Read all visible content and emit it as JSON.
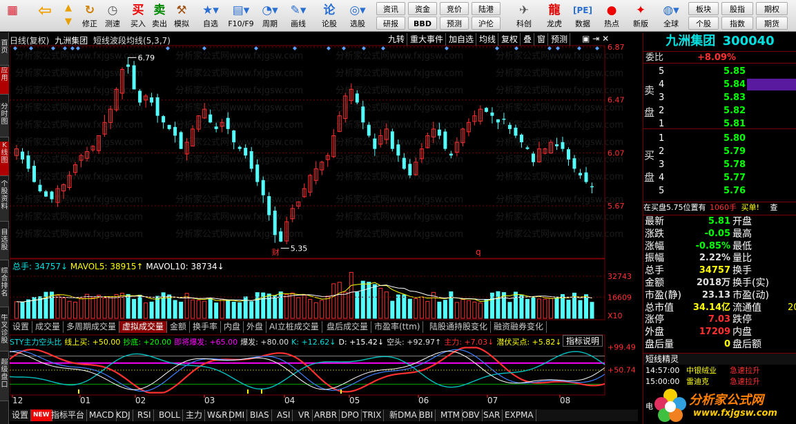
{
  "toolbar": {
    "buttons": [
      {
        "label": "",
        "icon": "back-arrow-icon"
      },
      {
        "label": "修正",
        "icon": "refresh-icon"
      },
      {
        "label": "测速",
        "icon": "clock-icon"
      },
      {
        "label": "买入",
        "icon": "buy-icon",
        "glyph": "买"
      },
      {
        "label": "卖出",
        "icon": "sell-icon",
        "glyph": "卖"
      },
      {
        "label": "模拟",
        "icon": "hammer-icon"
      },
      {
        "label": "自选",
        "icon": "star-icon"
      },
      {
        "label": "F10/F9",
        "icon": "document-icon"
      },
      {
        "label": "周期",
        "icon": "cycle-icon"
      },
      {
        "label": "画线",
        "icon": "pen-icon"
      },
      {
        "label": "论股",
        "icon": "discuss-icon"
      },
      {
        "label": "选股",
        "icon": "chart-select-icon"
      }
    ],
    "small_buttons": [
      "资讯",
      "资金",
      "竞价",
      "陆港",
      "研报",
      "BBD",
      "预测",
      "沪伦"
    ],
    "right_buttons": [
      {
        "label": "科创",
        "icon": "rocket-icon"
      },
      {
        "label": "龙虎",
        "icon": "dragon-icon"
      },
      {
        "label": "数据",
        "icon": "pe-icon"
      },
      {
        "label": "热点",
        "icon": "hot-icon"
      },
      {
        "label": "新版",
        "icon": "new-version-icon"
      },
      {
        "label": "全球",
        "icon": "globe-icon"
      }
    ],
    "far_right": [
      "板块",
      "股指",
      "期权",
      "个股",
      "指数",
      "期货"
    ]
  },
  "left_tabs": [
    "首页",
    "应用",
    "分时图",
    "K线图",
    "个股资料",
    "自选股",
    "综合排名",
    "牛叉诊股",
    "超级盘口"
  ],
  "chart": {
    "title_parts": [
      "日线(复权)",
      "九洲集团",
      "短线波段均线(5,3,7)"
    ],
    "top_buttons": [
      "九转",
      "重大事件",
      "加自选",
      "均线",
      "复权",
      "叠",
      "窗",
      "预测"
    ],
    "price_high_label": "6.79",
    "price_low_label": "5.35",
    "marker_cai": "财",
    "marker_q": "q",
    "watermark": "分析家公式网www.fxjgsw.com",
    "price_axis": [
      "6.87",
      "6.47",
      "6.07",
      "5.67"
    ],
    "vol_axis": [
      "32743",
      "16609",
      "X10"
    ],
    "osc_axis": [
      "+99.49",
      "+50.74"
    ],
    "volume_legend": [
      {
        "text": "总手: 34757↓",
        "color": "#00e0e0"
      },
      {
        "text": "MAVOL5: 38915↑",
        "color": "#ffff00"
      },
      {
        "text": "MAVOL10: 38734↓",
        "color": "#ffffff"
      }
    ],
    "tabs": [
      "设置",
      "成交量",
      "多周期成交量",
      "虚拟成交量",
      "金额",
      "换手率",
      "内盘",
      "外盘",
      "AI立桩成交量",
      "盘后成交量",
      "市盈率(ttm)",
      "陆股通持股变化",
      "融资融券变化"
    ],
    "active_tab": "虚拟成交量",
    "osc_legend": [
      {
        "text": "STY主力空头比",
        "color": "#00e0e0"
      },
      {
        "text": "线上买: +50.00",
        "color": "#ffff00"
      },
      {
        "text": "抄底: +20.00",
        "color": "#00ff00"
      },
      {
        "text": "即将爆发: +65.00",
        "color": "#ff00ff"
      },
      {
        "text": "爆发: +80.00",
        "color": "#e0e0e0"
      },
      {
        "text": "K: +12.62↓",
        "color": "#00e0e0"
      },
      {
        "text": "D: +15.42↓",
        "color": "#ffffff"
      },
      {
        "text": "空头: +92.97↑",
        "color": "#e0e0e0"
      },
      {
        "text": "主力: +7.03↓",
        "color": "#ff3030"
      },
      {
        "text": "潜伏买点: +5.82↓",
        "color": "#ffff00"
      }
    ],
    "osc_button": "指标说明",
    "months": [
      "12",
      "01",
      "02",
      "03",
      "04",
      "05",
      "06",
      "07",
      "08"
    ],
    "bottom_tabs": [
      "设置",
      "NEW",
      "指标平台",
      "MACD",
      "KDJ",
      "RSI",
      "BOLL",
      "主力",
      "W&R",
      "DMI",
      "BIAS",
      "ASI",
      "VR",
      "ARBR",
      "DPO",
      "TRIX",
      "新DMA",
      "BBI",
      "MTM",
      "OBV",
      "SAR",
      "EXPMA"
    ]
  },
  "chart_data": {
    "type": "candlestick",
    "months": [
      "12",
      "01",
      "02",
      "03",
      "04",
      "05",
      "06",
      "07",
      "08"
    ],
    "price_axis_ticks": [
      6.87,
      6.47,
      6.07,
      5.67
    ],
    "high": 6.79,
    "low": 5.35,
    "volume_axis_ticks": [
      32743,
      16609
    ],
    "volume": {
      "total": 34757,
      "mavol5": 38915,
      "mavol10": 38734
    },
    "oscillator": {
      "K": 12.62,
      "D": 15.42,
      "空头": 92.97,
      "主力": 7.03,
      "潜伏买点": 5.82,
      "线上买": 50.0,
      "抄底": 20.0,
      "即将爆发": 65.0,
      "爆发": 80.0
    },
    "close_path": [
      6.1,
      6.02,
      5.95,
      5.85,
      5.78,
      5.74,
      5.72,
      5.8,
      5.83,
      5.9,
      5.98,
      6.05,
      6.08,
      6.12,
      6.2,
      6.3,
      6.4,
      6.55,
      6.7,
      6.72,
      6.55,
      6.45,
      6.5,
      6.45,
      6.35,
      6.3,
      6.25,
      6.2,
      6.1,
      6.15,
      6.25,
      6.35,
      6.4,
      6.3,
      6.25,
      6.3,
      6.25,
      6.15,
      6.1,
      6.05,
      5.95,
      5.85,
      5.75,
      5.6,
      5.45,
      5.4,
      5.55,
      5.65,
      5.7,
      5.8,
      5.9,
      5.95,
      6.0,
      6.05,
      6.2,
      6.35,
      6.5,
      6.55,
      6.45,
      6.3,
      6.2,
      6.1,
      6.2,
      6.25,
      6.1,
      6.05,
      5.95,
      5.9,
      6.0,
      6.1,
      6.2,
      6.25,
      6.2,
      6.1,
      6.05,
      6.15,
      6.25,
      6.3,
      6.35,
      6.4,
      6.38,
      6.35,
      6.3,
      6.32,
      6.25,
      6.2,
      6.15,
      6.1,
      6.0,
      6.1,
      6.1,
      6.15,
      6.12,
      6.1,
      6.02,
      5.95,
      5.9,
      5.85,
      5.81
    ]
  },
  "panel": {
    "name": "九洲集团",
    "code": "300040",
    "weibi_label": "委比",
    "weibi_value": "+8.09%",
    "sell_side_label": "卖盘",
    "buy_side_label": "买盘",
    "sell": [
      {
        "n": "5",
        "p": "5.85"
      },
      {
        "n": "4",
        "p": "5.84"
      },
      {
        "n": "3",
        "p": "5.83"
      },
      {
        "n": "2",
        "p": "5.82"
      },
      {
        "n": "1",
        "p": "5.81"
      }
    ],
    "buy": [
      {
        "n": "1",
        "p": "5.80"
      },
      {
        "n": "2",
        "p": "5.79"
      },
      {
        "n": "3",
        "p": "5.78"
      },
      {
        "n": "4",
        "p": "5.77"
      },
      {
        "n": "5",
        "p": "5.76"
      }
    ],
    "notice_a": "在买盘5.75位置有",
    "notice_b": "1060手",
    "notice_c": "买单!",
    "notice_d": "查",
    "quote": [
      {
        "l": "最新",
        "v": "5.81",
        "r": "开盘",
        "c": "#00ff00"
      },
      {
        "l": "涨跌",
        "v": "-0.05",
        "r": "最高",
        "c": "#00ff00"
      },
      {
        "l": "涨幅",
        "v": "-0.85%",
        "r": "最低",
        "c": "#00ff00"
      },
      {
        "l": "振幅",
        "v": "2.22%",
        "r": "量比",
        "c": "#e0e0e0"
      },
      {
        "l": "总手",
        "v": "34757",
        "r": "换手",
        "c": "#ffff00"
      },
      {
        "l": "金额",
        "v": "2018万",
        "r": "换手(实)",
        "c": "#e0e0e0"
      },
      {
        "l": "市盈(静)",
        "v": "23.13",
        "r": "市盈(动)",
        "c": "#e0e0e0"
      },
      {
        "l": "总市值",
        "v": "34.14亿",
        "r": "流通值",
        "c": "#ffff00"
      },
      {
        "l": "涨停",
        "v": "7.03",
        "r": "跌停",
        "c": "#ff3030"
      },
      {
        "l": "外盘",
        "v": "17209",
        "r": "内盘",
        "c": "#ff3030"
      },
      {
        "l": "盘后量",
        "v": "0",
        "r": "盘后额",
        "c": "#ffff00"
      }
    ],
    "flow_value_tail": "20",
    "jingling_title": "短线精灵",
    "jingling": [
      {
        "t": "14:57:00",
        "n": "中银绒业",
        "e": "急速拉升"
      },
      {
        "t": "15:00:00",
        "n": "雷迪克",
        "e": "急速拉升"
      }
    ],
    "logo_text": "分析家公式网",
    "logo_url": "www.fxjgsw.com",
    "logo_glyph": "电"
  }
}
